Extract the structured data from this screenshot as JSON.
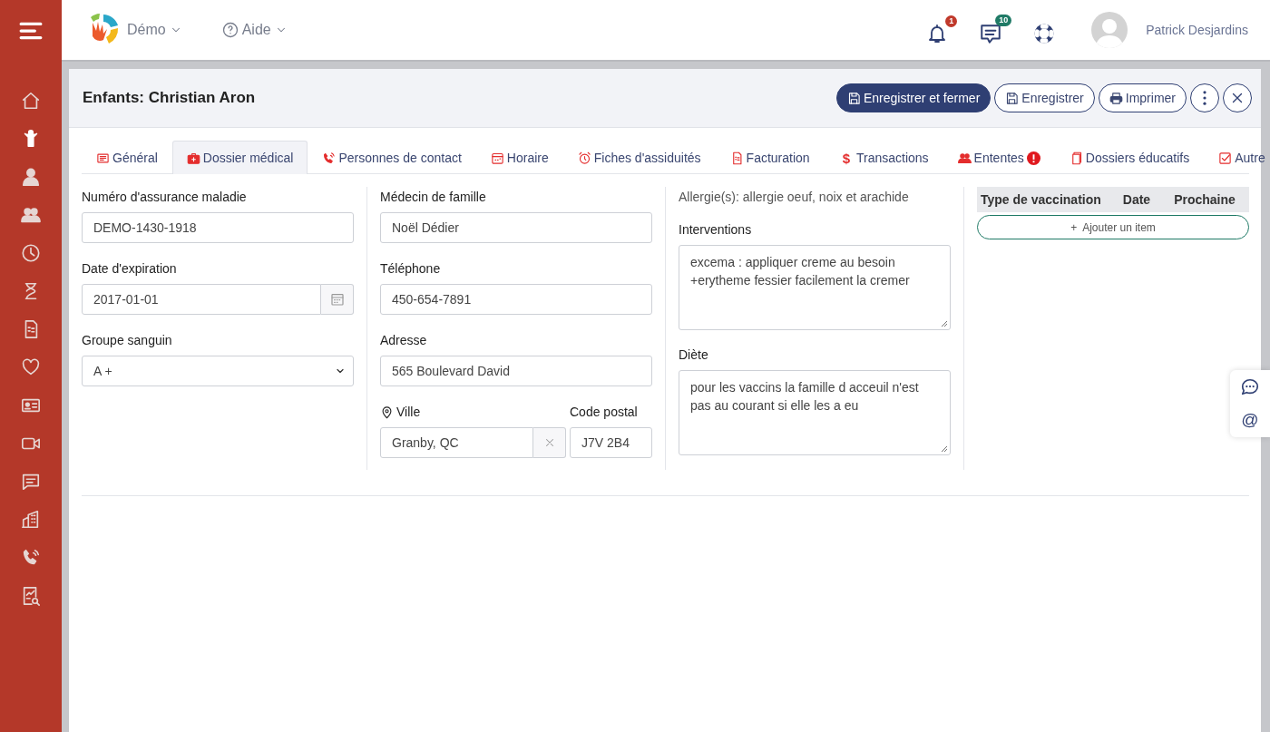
{
  "topbar": {
    "org": "Démo",
    "help": "Aide",
    "notifications": "1",
    "messages": "10",
    "user": "Patrick Desjardins"
  },
  "sidebar": {
    "items": [
      {
        "selected": false
      },
      {
        "selected": true
      },
      {
        "selected": false
      },
      {
        "selected": false
      },
      {
        "selected": false
      },
      {
        "selected": false
      },
      {
        "selected": false
      },
      {
        "selected": false
      },
      {
        "selected": false
      },
      {
        "selected": false
      },
      {
        "selected": false
      },
      {
        "selected": false
      },
      {
        "selected": false
      },
      {
        "selected": false
      }
    ]
  },
  "modal": {
    "title": "Enfants: Christian Aron",
    "buttons": [
      {
        "label": "Enregistrer et fermer",
        "kind": "primary"
      },
      {
        "label": "Enregistrer",
        "kind": "outline"
      },
      {
        "label": "Imprimer",
        "kind": "print"
      }
    ],
    "tabs": [
      {
        "label": "Général",
        "selected": false
      },
      {
        "label": "Dossier médical",
        "selected": true
      },
      {
        "label": "Personnes de contact",
        "selected": false
      },
      {
        "label": "Horaire",
        "selected": false
      },
      {
        "label": "Fiches d'assiduités",
        "selected": false
      },
      {
        "label": "Facturation",
        "selected": false
      },
      {
        "label": "Transactions",
        "selected": false,
        "symbol": "$"
      },
      {
        "label": "Ententes",
        "selected": false,
        "alert": true
      },
      {
        "label": "Dossiers éducatifs",
        "selected": false
      },
      {
        "label": "Autre",
        "selected": false
      }
    ],
    "column_1": [
      {
        "label": "Numéro d'assurance maladie",
        "value": "DEMO-1430-1918",
        "kind": "text"
      },
      {
        "label": "Date d'expiration",
        "value": "2017-01-01",
        "kind": "date"
      },
      {
        "label": "Groupe sanguin",
        "value": "A +",
        "kind": "select"
      }
    ],
    "column_2": [
      {
        "label": "Médecin de famille",
        "value": "Noël Dédier",
        "kind": "text"
      },
      {
        "label": "Téléphone",
        "value": "450-654-7891",
        "kind": "text"
      },
      {
        "label": "Adresse",
        "value": "565 Boulevard David",
        "kind": "text"
      }
    ],
    "city": {
      "label": "Ville",
      "value": "Granby, QC"
    },
    "postal_code": {
      "label": "Code postal",
      "value": "J7V 2B4"
    },
    "allergies": "Allergie(s): allergie oeuf, noix et arachide",
    "column_3": [
      {
        "label": "Interventions",
        "value": "excema : appliquer creme au besoin\n+erytheme fessier facilement la cremer"
      },
      {
        "label": "Diète",
        "value": "pour les vaccins la famille d acceuil n'est pas au courant si elle les a eu"
      }
    ],
    "vaccinations": {
      "columns": [
        "Type de vaccination",
        "Date",
        "Prochaine"
      ],
      "add_button": "+  Ajouter un item"
    }
  },
  "floating": {
    "at": "@"
  }
}
